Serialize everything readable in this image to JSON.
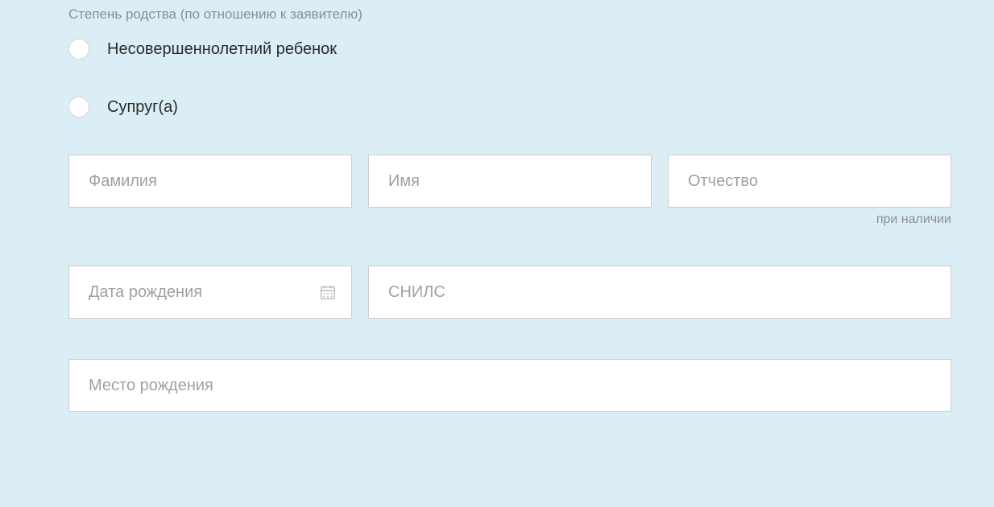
{
  "group_label": "Степень родства (по отношению к заявителю)",
  "radios": {
    "minor_child": "Несовершеннолетний ребенок",
    "spouse": "Супруг(а)"
  },
  "fields": {
    "lastname": {
      "placeholder": "Фамилия",
      "value": ""
    },
    "firstname": {
      "placeholder": "Имя",
      "value": ""
    },
    "patronymic": {
      "placeholder": "Отчество",
      "value": "",
      "hint": "при наличии"
    },
    "dob": {
      "placeholder": "Дата рождения",
      "value": ""
    },
    "snils": {
      "placeholder": "СНИЛС",
      "value": ""
    },
    "pob": {
      "placeholder": "Место рождения",
      "value": ""
    }
  }
}
